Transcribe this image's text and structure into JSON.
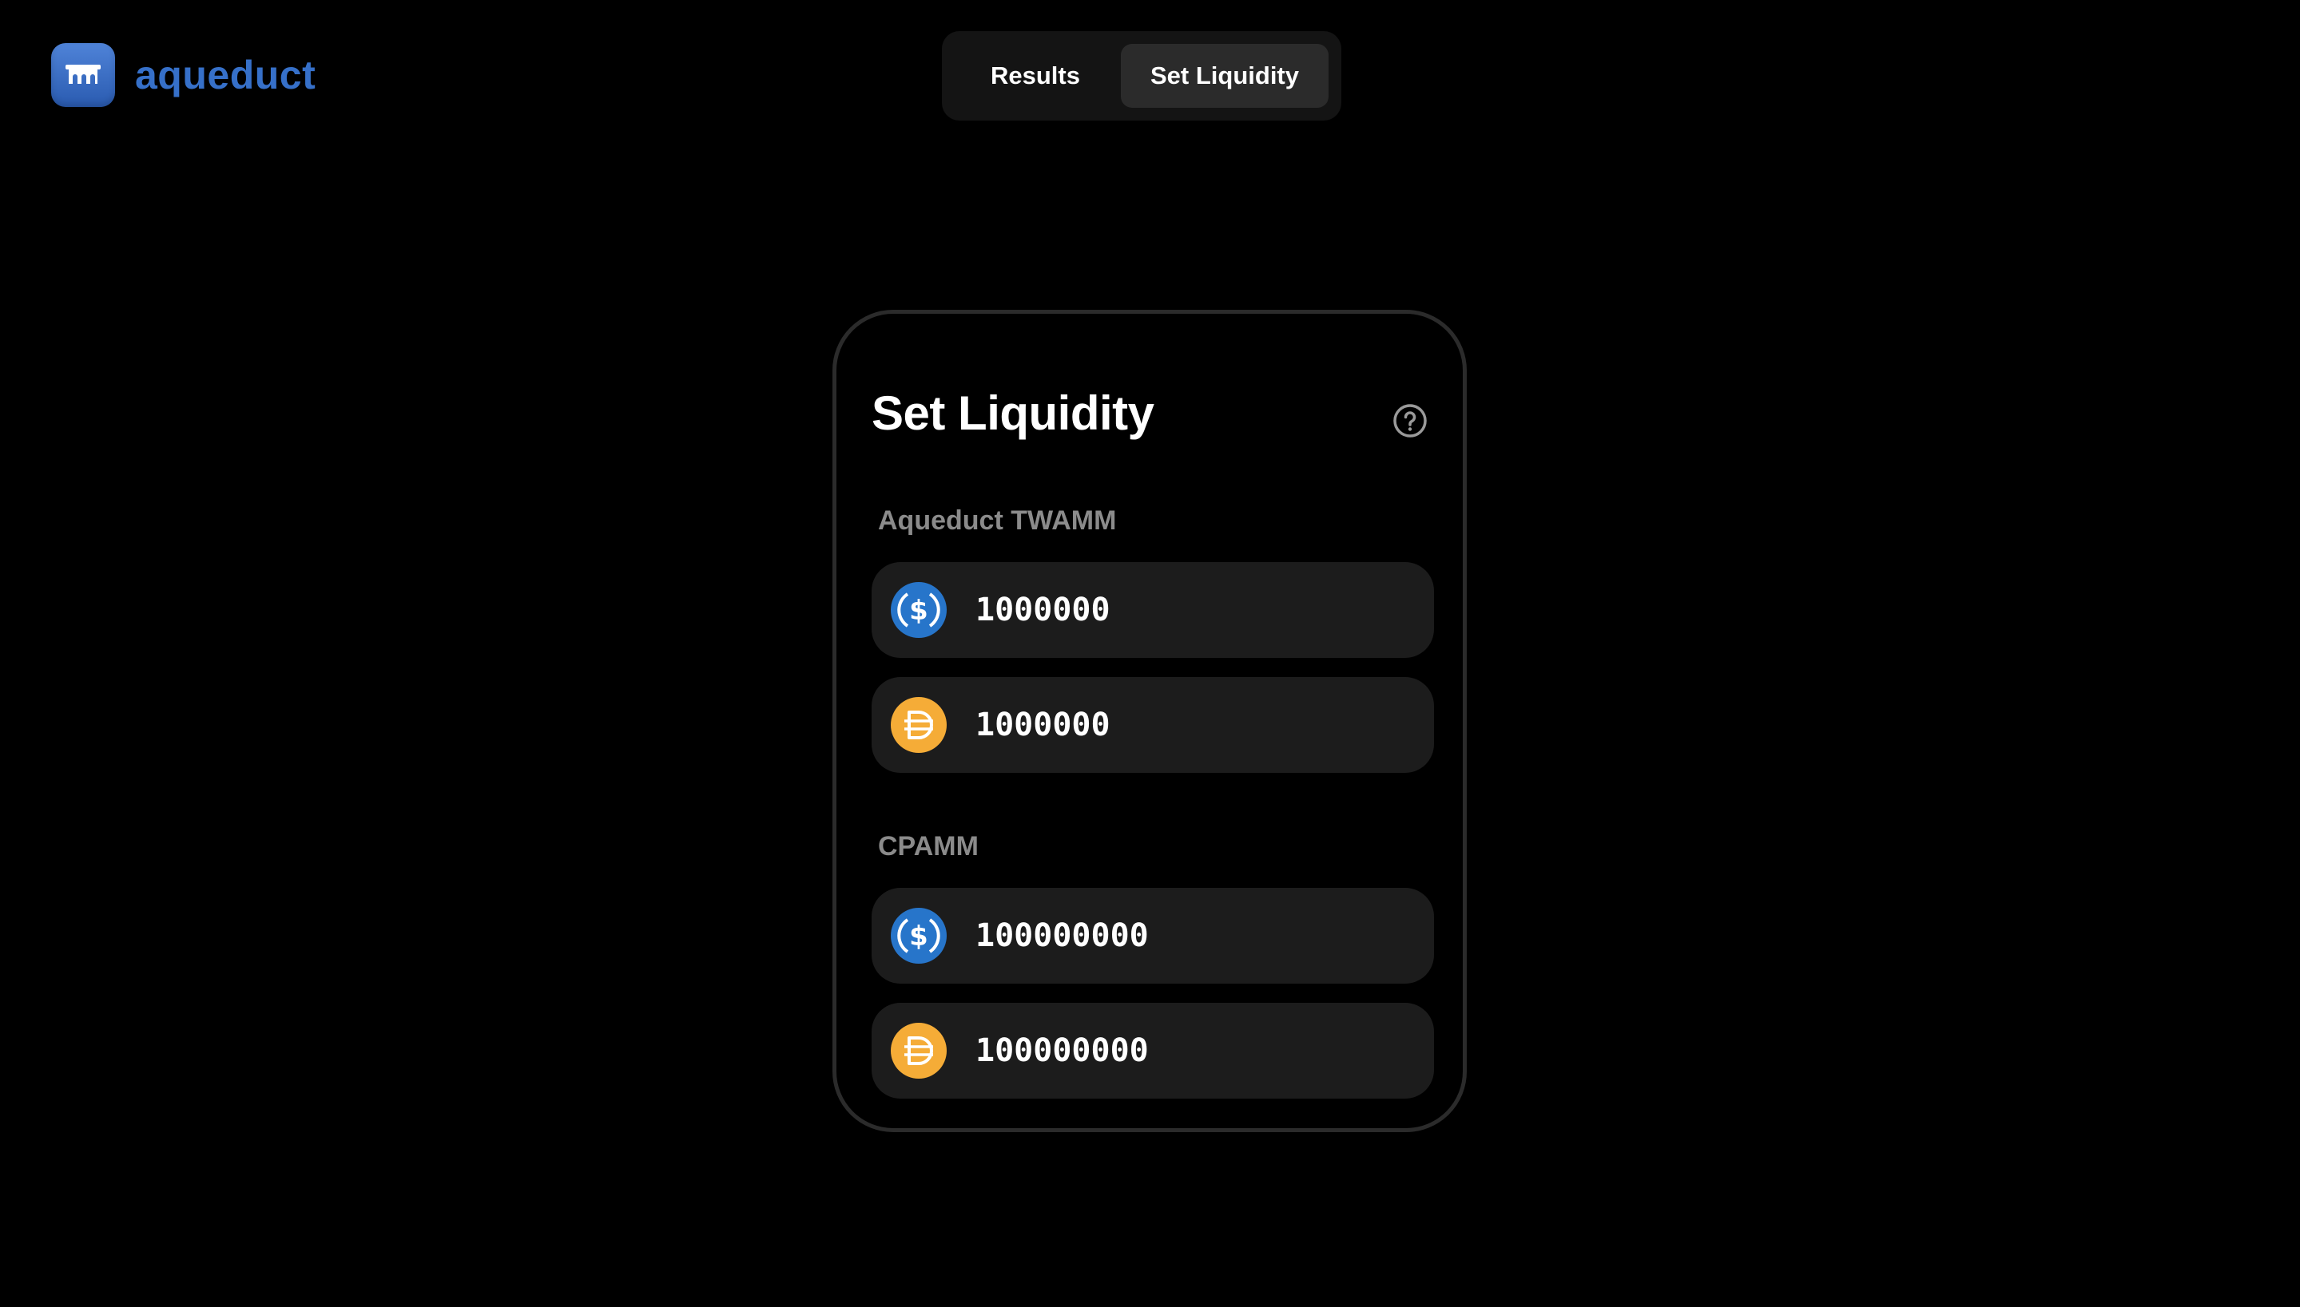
{
  "app": {
    "name": "aqueduct"
  },
  "nav": {
    "tabs": [
      {
        "label": "Results",
        "active": false
      },
      {
        "label": "Set Liquidity",
        "active": true
      }
    ]
  },
  "card": {
    "title": "Set Liquidity",
    "help_icon": "question-circle-icon",
    "sections": [
      {
        "label": "Aqueduct TWAMM",
        "rows": [
          {
            "token_icon": "usdc-icon",
            "value": "1000000"
          },
          {
            "token_icon": "dai-icon",
            "value": "1000000"
          }
        ]
      },
      {
        "label": "CPAMM",
        "rows": [
          {
            "token_icon": "usdc-icon",
            "value": "100000000"
          },
          {
            "token_icon": "dai-icon",
            "value": "100000000"
          }
        ]
      }
    ]
  },
  "colors": {
    "background": "#000000",
    "brand_blue": "#3670c9",
    "usdc_blue": "#2775ca",
    "dai_orange": "#f5ac37",
    "row_bg": "#1c1c1c",
    "card_border": "#2b2b2b",
    "active_tab_bg": "#2b2b2b",
    "section_label": "#8b8b8b"
  }
}
